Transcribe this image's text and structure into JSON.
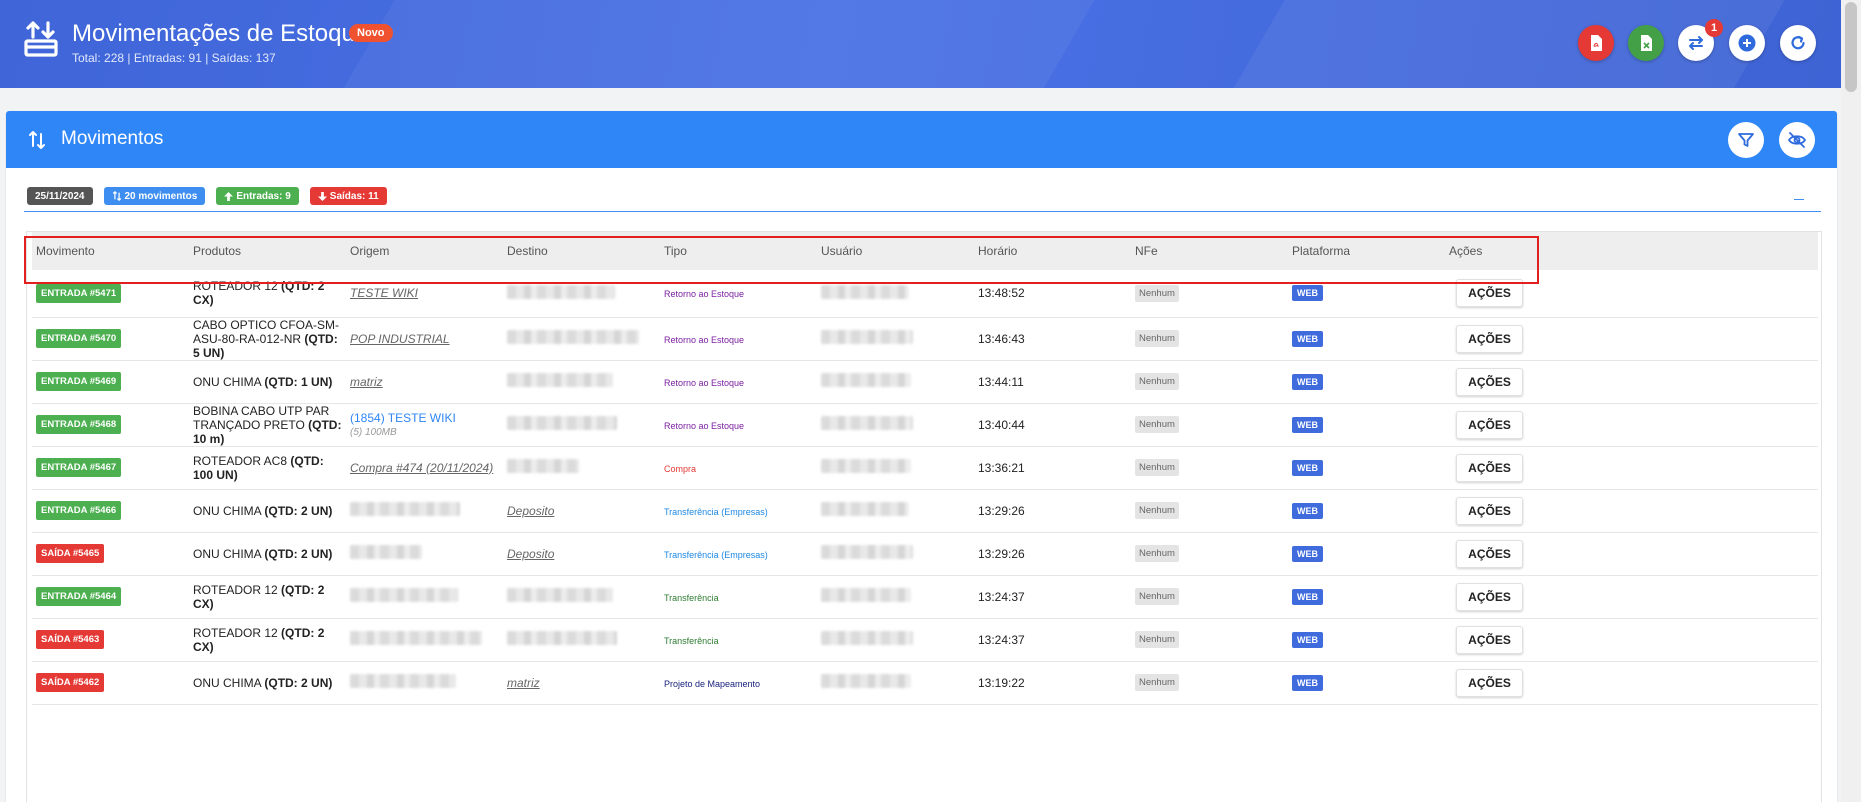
{
  "header": {
    "title": "Movimentações de Estoque",
    "badge": "Novo",
    "subtitle": "Total: 228 | Entradas: 91 | Saídas: 137",
    "notification_count": "1",
    "buttons": [
      "pdf-icon",
      "spreadsheet-icon",
      "transfer-icon",
      "add-icon",
      "refresh-icon"
    ]
  },
  "panel": {
    "title": "Movimentos",
    "chips": {
      "date": "25/11/2024",
      "movements": "20 movimentos",
      "entries": "Entradas: 9",
      "exits": "Saídas: 11"
    }
  },
  "table": {
    "columns": [
      "Movimento",
      "Produtos",
      "Origem",
      "Destino",
      "Tipo",
      "Usuário",
      "Horário",
      "NFe",
      "Plataforma",
      "Ações"
    ],
    "rows": [
      {
        "mov": "ENTRADA #5471",
        "kind": "in",
        "prod": "ROTEADOR 12",
        "qtd": "(QTD: 2 CX)",
        "origem": "TESTE WIKI",
        "origem_style": "link",
        "origem_sub": "",
        "destino": "",
        "tipo": "Retorno ao Estoque",
        "tipo_color": "#7b1fa2",
        "usuario": "",
        "hora": "13:48:52",
        "nfe": "Nenhum",
        "plat": "WEB",
        "acoes": "AÇÕES"
      },
      {
        "mov": "ENTRADA #5470",
        "kind": "in",
        "prod": "CABO OPTICO CFOA-SM-ASU-80-RA-012-NR",
        "qtd": "(QTD: 5 UN)",
        "origem": "POP INDUSTRIAL",
        "origem_style": "link",
        "origem_sub": "",
        "destino": "",
        "tipo": "Retorno ao Estoque",
        "tipo_color": "#7b1fa2",
        "usuario": "",
        "hora": "13:46:43",
        "nfe": "Nenhum",
        "plat": "WEB",
        "acoes": "AÇÕES"
      },
      {
        "mov": "ENTRADA #5469",
        "kind": "in",
        "prod": "ONU CHIMA",
        "qtd": "(QTD: 1 UN)",
        "origem": "matriz",
        "origem_style": "link",
        "origem_sub": "",
        "destino": "",
        "tipo": "Retorno ao Estoque",
        "tipo_color": "#7b1fa2",
        "usuario": "",
        "hora": "13:44:11",
        "nfe": "Nenhum",
        "plat": "WEB",
        "acoes": "AÇÕES"
      },
      {
        "mov": "ENTRADA #5468",
        "kind": "in",
        "prod": "BOBINA CABO UTP PAR TRANÇADO PRETO",
        "qtd": "(QTD: 10 m)",
        "origem": "(1854) TESTE WIKI",
        "origem_style": "blue",
        "origem_sub": "(5) 100MB",
        "destino": "",
        "tipo": "Retorno ao Estoque",
        "tipo_color": "#7b1fa2",
        "usuario": "",
        "hora": "13:40:44",
        "nfe": "Nenhum",
        "plat": "WEB",
        "acoes": "AÇÕES"
      },
      {
        "mov": "ENTRADA #5467",
        "kind": "in",
        "prod": "ROTEADOR AC8",
        "qtd": "(QTD: 100 UN)",
        "origem": "Compra #474 (20/11/2024)",
        "origem_style": "link",
        "origem_sub": "",
        "destino": "",
        "tipo": "Compra",
        "tipo_color": "#e53935",
        "usuario": "",
        "hora": "13:36:21",
        "nfe": "Nenhum",
        "plat": "WEB",
        "acoes": "AÇÕES"
      },
      {
        "mov": "ENTRADA #5466",
        "kind": "in",
        "prod": "ONU CHIMA",
        "qtd": "(QTD: 2 UN)",
        "origem": "",
        "origem_style": "blur",
        "origem_sub": "",
        "destino": "Deposito",
        "tipo": "Transferência (Empresas)",
        "tipo_color": "#1e88e5",
        "usuario": "",
        "hora": "13:29:26",
        "nfe": "Nenhum",
        "plat": "WEB",
        "acoes": "AÇÕES"
      },
      {
        "mov": "SAÍDA #5465",
        "kind": "out",
        "prod": "ONU CHIMA",
        "qtd": "(QTD: 2 UN)",
        "origem": "",
        "origem_style": "blur",
        "origem_sub": "",
        "destino": "Deposito",
        "tipo": "Transferência (Empresas)",
        "tipo_color": "#1e88e5",
        "usuario": "",
        "hora": "13:29:26",
        "nfe": "Nenhum",
        "plat": "WEB",
        "acoes": "AÇÕES"
      },
      {
        "mov": "ENTRADA #5464",
        "kind": "in",
        "prod": "ROTEADOR 12",
        "qtd": "(QTD: 2 CX)",
        "origem": "",
        "origem_style": "blur",
        "origem_sub": "",
        "destino": "",
        "tipo": "Transferência",
        "tipo_color": "#2e7d32",
        "usuario": "",
        "hora": "13:24:37",
        "nfe": "Nenhum",
        "plat": "WEB",
        "acoes": "AÇÕES"
      },
      {
        "mov": "SAÍDA #5463",
        "kind": "out",
        "prod": "ROTEADOR 12",
        "qtd": "(QTD: 2 CX)",
        "origem": "",
        "origem_style": "blur",
        "origem_sub": "",
        "destino": "",
        "tipo": "Transferência",
        "tipo_color": "#2e7d32",
        "usuario": "",
        "hora": "13:24:37",
        "nfe": "Nenhum",
        "plat": "WEB",
        "acoes": "AÇÕES"
      },
      {
        "mov": "SAÍDA #5462",
        "kind": "out",
        "prod": "ONU CHIMA",
        "qtd": "(QTD: 2 UN)",
        "origem": "",
        "origem_style": "blur",
        "origem_sub": "",
        "destino": "matriz",
        "tipo": "Projeto de Mapeamento",
        "tipo_color": "#1a237e",
        "usuario": "",
        "hora": "13:19:22",
        "nfe": "Nenhum",
        "plat": "WEB",
        "acoes": "AÇÕES"
      }
    ]
  },
  "colors": {
    "header_bg": "#4a72e6",
    "panel_header_bg": "#2f86f6",
    "entrada": "#4caf50",
    "saida": "#e53935",
    "web_badge": "#3f6bdc",
    "highlight": "#e32020"
  }
}
